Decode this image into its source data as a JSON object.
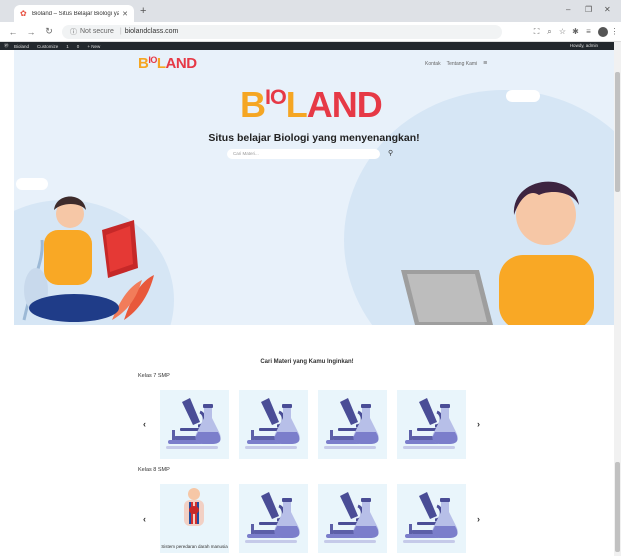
{
  "browser": {
    "tab_title": "Bioland – Situs Belajar Biologi ya...",
    "new_tab": "+",
    "security_label": "Not secure",
    "url": "biolandclass.com"
  },
  "adminbar": {
    "items": [
      "Bioland",
      "Customize",
      "1",
      "0",
      "+ New"
    ],
    "howdy": "Howdy, admin"
  },
  "site": {
    "logo": {
      "b": "B",
      "io": "IO",
      "l": "L",
      "and": "AND"
    },
    "nav": {
      "contact": "Kontak",
      "about": "Tentang Kami"
    },
    "tagline": "Situs belajar Biologi yang menyenangkan!",
    "search_placeholder": "Cari Materi..."
  },
  "materials": {
    "title": "Cari Materi yang Kamu Inginkan!",
    "groups": [
      {
        "label": "Kelas 7 SMP",
        "cards": [
          "",
          "",
          "",
          ""
        ]
      },
      {
        "label": "Kelas 8 SMP",
        "cards": [
          "Sistem peredaran darah manusia",
          "",
          "",
          ""
        ]
      }
    ]
  },
  "colors": {
    "accent_orange": "#f5a623",
    "accent_red": "#e63946",
    "hero_bg": "#e8f1fa",
    "card_bg": "#e9f5fb",
    "icon_purple": "#7b7ecb"
  }
}
